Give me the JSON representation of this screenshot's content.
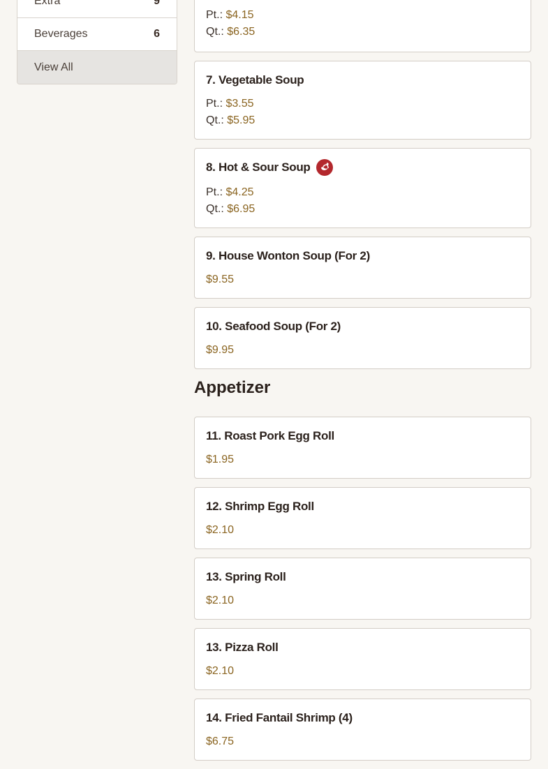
{
  "sidebar": {
    "items": [
      {
        "label": "Extra",
        "count": "9"
      },
      {
        "label": "Beverages",
        "count": "6"
      }
    ],
    "view_all": "View All"
  },
  "menu": {
    "card_item6": {
      "pt_label": "Pt.:",
      "pt_price": "$4.15",
      "qt_label": "Qt.:",
      "qt_price": "$6.35"
    },
    "card_item7": {
      "title": "7. Vegetable Soup",
      "pt_label": "Pt.:",
      "pt_price": "$3.55",
      "qt_label": "Qt.:",
      "qt_price": "$5.95"
    },
    "card_item8": {
      "title": "8. Hot & Sour Soup",
      "icon": "spicy-chili-icon",
      "pt_label": "Pt.:",
      "pt_price": "$4.25",
      "qt_label": "Qt.:",
      "qt_price": "$6.95"
    },
    "card_item9": {
      "title": "9. House Wonton Soup (For 2)",
      "price": "$9.55"
    },
    "card_item10": {
      "title": "10. Seafood Soup (For 2)",
      "price": "$9.95"
    },
    "section_appetizer": "Appetizer",
    "card_item11": {
      "title": "11. Roast Pork Egg Roll",
      "price": "$1.95"
    },
    "card_item12": {
      "title": "12. Shrimp Egg Roll",
      "price": "$2.10"
    },
    "card_item13a": {
      "title": "13. Spring Roll",
      "price": "$2.10"
    },
    "card_item13b": {
      "title": "13. Pizza Roll",
      "price": "$2.10"
    },
    "card_item14": {
      "title": "14. Fried Fantail Shrimp (4)",
      "price": "$6.75"
    }
  },
  "colors": {
    "price": "#8a6420",
    "spicy": "#b3282d",
    "background": "#f8f6f2"
  }
}
